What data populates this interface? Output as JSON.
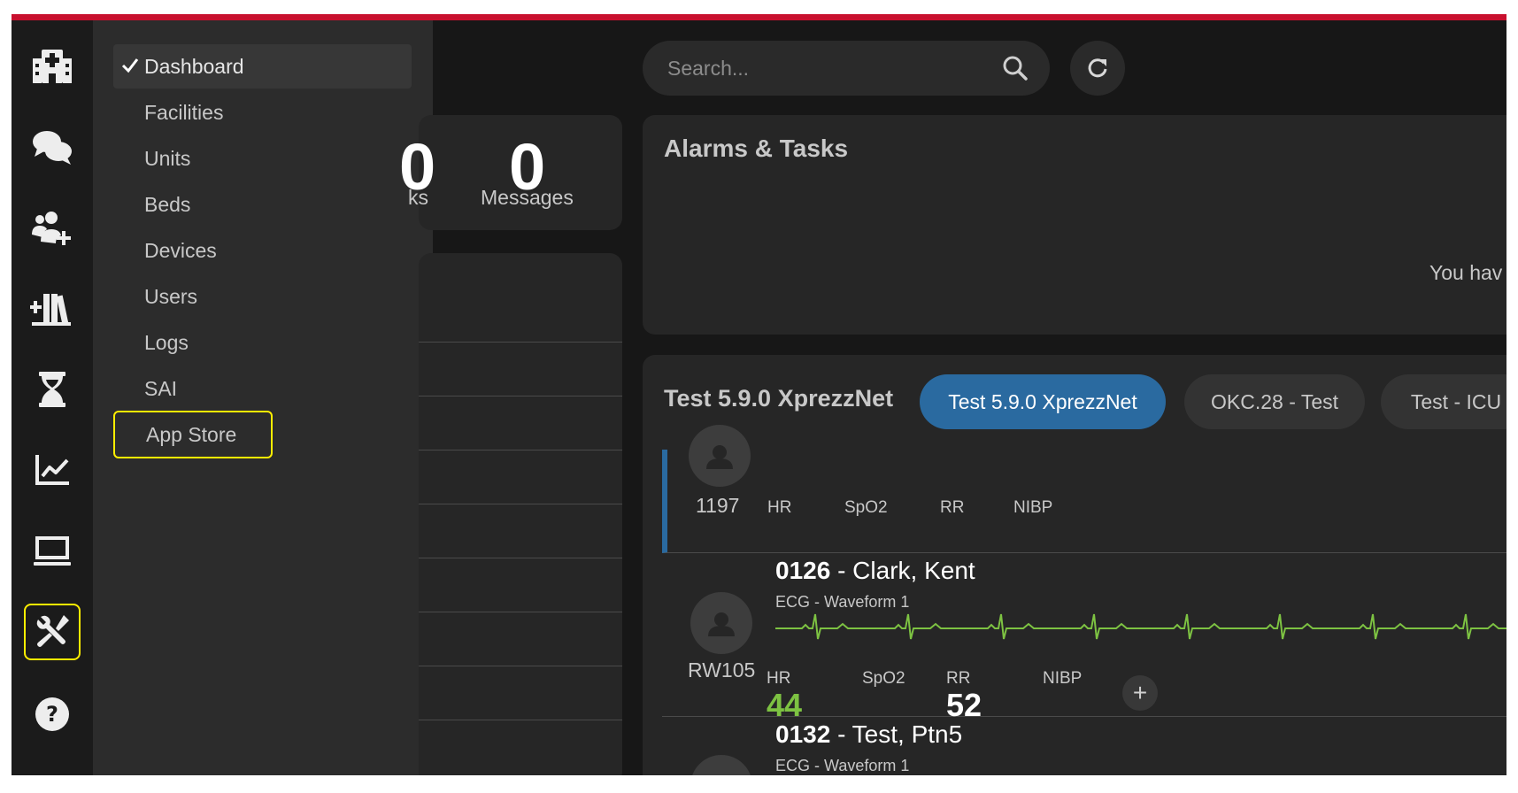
{
  "menu": {
    "items": [
      {
        "label": "Dashboard"
      },
      {
        "label": "Facilities"
      },
      {
        "label": "Units"
      },
      {
        "label": "Beds"
      },
      {
        "label": "Devices"
      },
      {
        "label": "Users"
      },
      {
        "label": "Logs"
      },
      {
        "label": "SAI"
      },
      {
        "label": "App Store"
      }
    ]
  },
  "stats": {
    "tasks_count": "0",
    "tasks_label": "ks",
    "messages_count": "0",
    "messages_label": "Messages"
  },
  "search": {
    "placeholder": "Search..."
  },
  "alarms": {
    "title": "Alarms & Tasks",
    "empty_text": "You hav"
  },
  "unit": {
    "title": "Test 5.9.0 XprezzNet",
    "tabs": [
      {
        "label": "Test 5.9.0 XprezzNet"
      },
      {
        "label": "OKC.28 - Test"
      },
      {
        "label": "Test - ICU"
      }
    ]
  },
  "patients": [
    {
      "bed": "1197",
      "vitals": {
        "hr": "HR",
        "spo2": "SpO2",
        "rr": "RR",
        "nibp": "NIBP"
      }
    },
    {
      "bed": "RW105",
      "mrn": "0126",
      "name": " - Clark, Kent",
      "waveform": "ECG - Waveform 1",
      "vitals": {
        "hr": "HR",
        "spo2": "SpO2",
        "rr": "RR",
        "nibp": "NIBP"
      },
      "hr_value": "44",
      "rr_value": "52",
      "add_label": "+"
    },
    {
      "mrn": "0132",
      "name": " - Test, Ptn5",
      "waveform": "ECG - Waveform 1"
    }
  ],
  "colors": {
    "accent_red": "#c8102e",
    "active_blue": "#2a6aa0",
    "hr_green": "#7dc242",
    "highlight": "#ffee00"
  }
}
